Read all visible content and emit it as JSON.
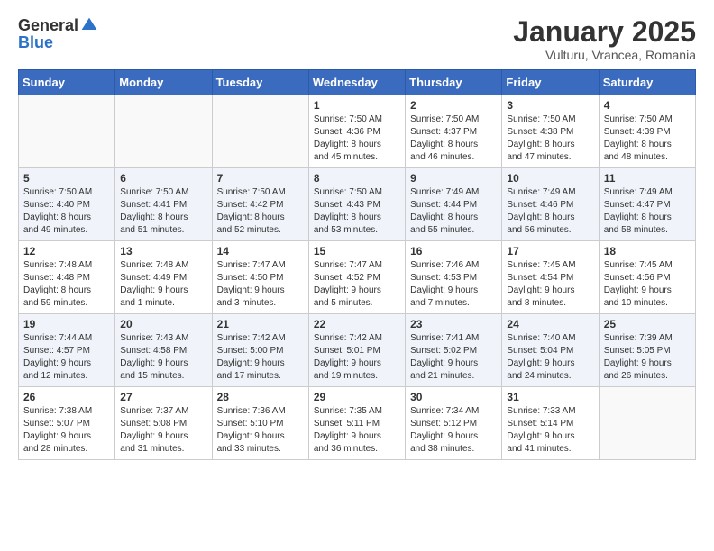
{
  "header": {
    "logo_general": "General",
    "logo_blue": "Blue",
    "month_title": "January 2025",
    "location": "Vulturu, Vrancea, Romania"
  },
  "days_of_week": [
    "Sunday",
    "Monday",
    "Tuesday",
    "Wednesday",
    "Thursday",
    "Friday",
    "Saturday"
  ],
  "weeks": [
    [
      {
        "day": "",
        "text": ""
      },
      {
        "day": "",
        "text": ""
      },
      {
        "day": "",
        "text": ""
      },
      {
        "day": "1",
        "text": "Sunrise: 7:50 AM\nSunset: 4:36 PM\nDaylight: 8 hours\nand 45 minutes."
      },
      {
        "day": "2",
        "text": "Sunrise: 7:50 AM\nSunset: 4:37 PM\nDaylight: 8 hours\nand 46 minutes."
      },
      {
        "day": "3",
        "text": "Sunrise: 7:50 AM\nSunset: 4:38 PM\nDaylight: 8 hours\nand 47 minutes."
      },
      {
        "day": "4",
        "text": "Sunrise: 7:50 AM\nSunset: 4:39 PM\nDaylight: 8 hours\nand 48 minutes."
      }
    ],
    [
      {
        "day": "5",
        "text": "Sunrise: 7:50 AM\nSunset: 4:40 PM\nDaylight: 8 hours\nand 49 minutes."
      },
      {
        "day": "6",
        "text": "Sunrise: 7:50 AM\nSunset: 4:41 PM\nDaylight: 8 hours\nand 51 minutes."
      },
      {
        "day": "7",
        "text": "Sunrise: 7:50 AM\nSunset: 4:42 PM\nDaylight: 8 hours\nand 52 minutes."
      },
      {
        "day": "8",
        "text": "Sunrise: 7:50 AM\nSunset: 4:43 PM\nDaylight: 8 hours\nand 53 minutes."
      },
      {
        "day": "9",
        "text": "Sunrise: 7:49 AM\nSunset: 4:44 PM\nDaylight: 8 hours\nand 55 minutes."
      },
      {
        "day": "10",
        "text": "Sunrise: 7:49 AM\nSunset: 4:46 PM\nDaylight: 8 hours\nand 56 minutes."
      },
      {
        "day": "11",
        "text": "Sunrise: 7:49 AM\nSunset: 4:47 PM\nDaylight: 8 hours\nand 58 minutes."
      }
    ],
    [
      {
        "day": "12",
        "text": "Sunrise: 7:48 AM\nSunset: 4:48 PM\nDaylight: 8 hours\nand 59 minutes."
      },
      {
        "day": "13",
        "text": "Sunrise: 7:48 AM\nSunset: 4:49 PM\nDaylight: 9 hours\nand 1 minute."
      },
      {
        "day": "14",
        "text": "Sunrise: 7:47 AM\nSunset: 4:50 PM\nDaylight: 9 hours\nand 3 minutes."
      },
      {
        "day": "15",
        "text": "Sunrise: 7:47 AM\nSunset: 4:52 PM\nDaylight: 9 hours\nand 5 minutes."
      },
      {
        "day": "16",
        "text": "Sunrise: 7:46 AM\nSunset: 4:53 PM\nDaylight: 9 hours\nand 7 minutes."
      },
      {
        "day": "17",
        "text": "Sunrise: 7:45 AM\nSunset: 4:54 PM\nDaylight: 9 hours\nand 8 minutes."
      },
      {
        "day": "18",
        "text": "Sunrise: 7:45 AM\nSunset: 4:56 PM\nDaylight: 9 hours\nand 10 minutes."
      }
    ],
    [
      {
        "day": "19",
        "text": "Sunrise: 7:44 AM\nSunset: 4:57 PM\nDaylight: 9 hours\nand 12 minutes."
      },
      {
        "day": "20",
        "text": "Sunrise: 7:43 AM\nSunset: 4:58 PM\nDaylight: 9 hours\nand 15 minutes."
      },
      {
        "day": "21",
        "text": "Sunrise: 7:42 AM\nSunset: 5:00 PM\nDaylight: 9 hours\nand 17 minutes."
      },
      {
        "day": "22",
        "text": "Sunrise: 7:42 AM\nSunset: 5:01 PM\nDaylight: 9 hours\nand 19 minutes."
      },
      {
        "day": "23",
        "text": "Sunrise: 7:41 AM\nSunset: 5:02 PM\nDaylight: 9 hours\nand 21 minutes."
      },
      {
        "day": "24",
        "text": "Sunrise: 7:40 AM\nSunset: 5:04 PM\nDaylight: 9 hours\nand 24 minutes."
      },
      {
        "day": "25",
        "text": "Sunrise: 7:39 AM\nSunset: 5:05 PM\nDaylight: 9 hours\nand 26 minutes."
      }
    ],
    [
      {
        "day": "26",
        "text": "Sunrise: 7:38 AM\nSunset: 5:07 PM\nDaylight: 9 hours\nand 28 minutes."
      },
      {
        "day": "27",
        "text": "Sunrise: 7:37 AM\nSunset: 5:08 PM\nDaylight: 9 hours\nand 31 minutes."
      },
      {
        "day": "28",
        "text": "Sunrise: 7:36 AM\nSunset: 5:10 PM\nDaylight: 9 hours\nand 33 minutes."
      },
      {
        "day": "29",
        "text": "Sunrise: 7:35 AM\nSunset: 5:11 PM\nDaylight: 9 hours\nand 36 minutes."
      },
      {
        "day": "30",
        "text": "Sunrise: 7:34 AM\nSunset: 5:12 PM\nDaylight: 9 hours\nand 38 minutes."
      },
      {
        "day": "31",
        "text": "Sunrise: 7:33 AM\nSunset: 5:14 PM\nDaylight: 9 hours\nand 41 minutes."
      },
      {
        "day": "",
        "text": ""
      }
    ]
  ]
}
